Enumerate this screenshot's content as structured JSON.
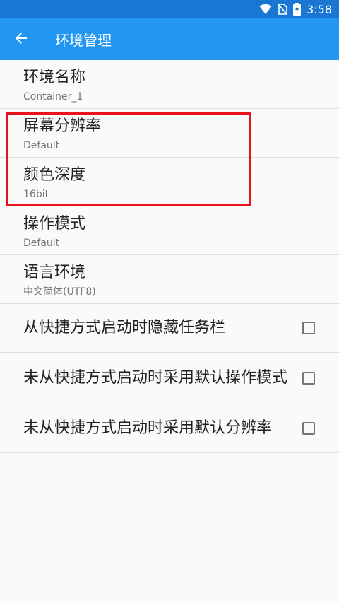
{
  "status_bar": {
    "time": "3:58",
    "icons": [
      "wifi-icon",
      "no-sim-icon",
      "battery-charging-icon"
    ]
  },
  "app_bar": {
    "back_icon": "arrow-back-icon",
    "title": "环境管理"
  },
  "preferences": [
    {
      "title": "环境名称",
      "summary": "Container_1"
    },
    {
      "title": "屏幕分辨率",
      "summary": "Default"
    },
    {
      "title": "颜色深度",
      "summary": "16bit"
    },
    {
      "title": "操作模式",
      "summary": "Default"
    },
    {
      "title": "语言环境",
      "summary": "中文简体(UTF8)"
    }
  ],
  "checkboxes": [
    {
      "title": "从快捷方式启动时隐藏任务栏",
      "checked": false
    },
    {
      "title": "未从快捷方式启动时采用默认操作模式",
      "checked": false
    },
    {
      "title": "未从快捷方式启动时采用默认分辨率",
      "checked": false
    }
  ],
  "colors": {
    "status_bar": "#1976d2",
    "app_bar": "#2196f3",
    "highlight_box": "#e8131c"
  }
}
